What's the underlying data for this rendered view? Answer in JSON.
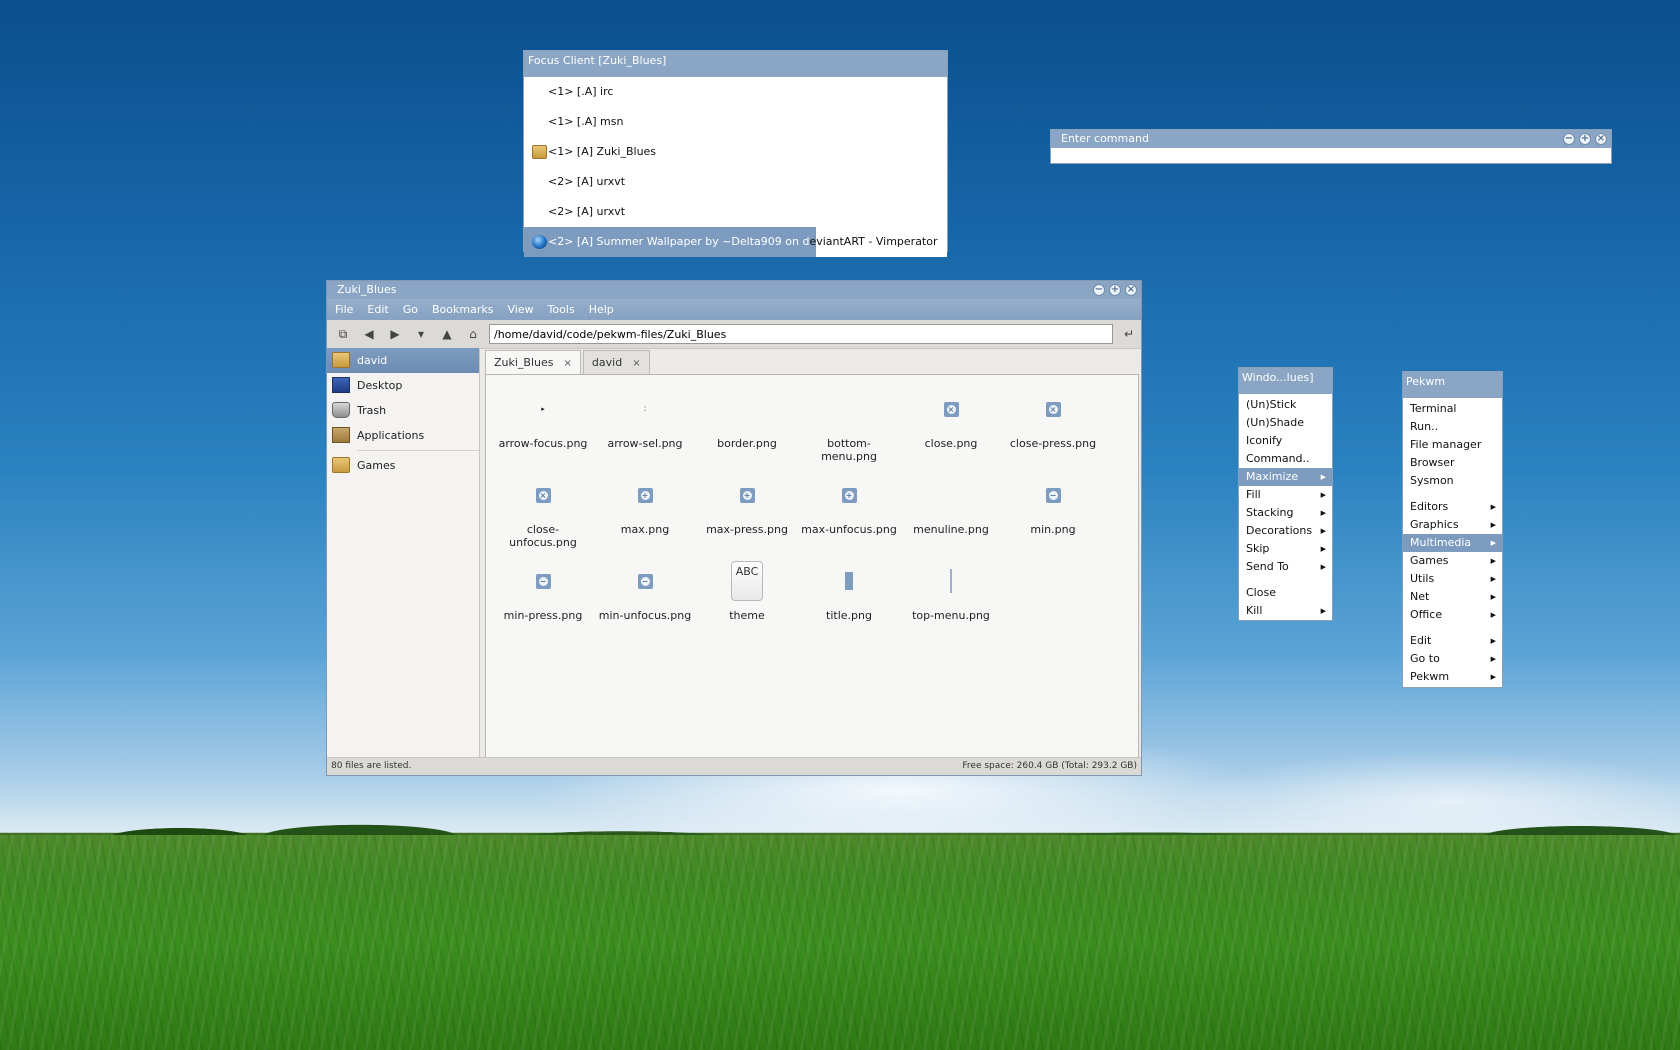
{
  "focus_window": {
    "title": "Focus Client [Zuki_Blues]",
    "items": [
      {
        "label": "<1> [.A] irc",
        "icon": "none"
      },
      {
        "label": "<1> [.A] msn",
        "icon": "none"
      },
      {
        "label": "<1> [A] Zuki_Blues",
        "icon": "folder-icon"
      },
      {
        "label": "<2> [A] urxvt",
        "icon": "none"
      },
      {
        "label": "<2> [A] urxvt",
        "icon": "none"
      },
      {
        "label_selected": "<2> [A] Summer Wallpaper by ~Delta909 on d",
        "label_tail": "eviantART - Vimperator",
        "icon": "globe-icon"
      }
    ]
  },
  "command_window": {
    "title": "Enter command",
    "value": ""
  },
  "file_manager": {
    "title": "Zuki_Blues",
    "menu": [
      "File",
      "Edit",
      "Go",
      "Bookmarks",
      "View",
      "Tools",
      "Help"
    ],
    "path": "/home/david/code/pekwm-files/Zuki_Blues",
    "sidebar": [
      {
        "label": "david",
        "icon": "home-folder-icon"
      },
      {
        "label": "Desktop",
        "icon": "desktop-icon"
      },
      {
        "label": "Trash",
        "icon": "trash-icon"
      },
      {
        "label": "Applications",
        "icon": "applications-icon"
      },
      {
        "label": "Games",
        "icon": "folder-icon"
      }
    ],
    "tabs": [
      {
        "label": "Zuki_Blues",
        "close": "×"
      },
      {
        "label": "david",
        "close": "×"
      }
    ],
    "files": [
      {
        "name": "arrow-focus.png",
        "thumb": "arrow"
      },
      {
        "name": "arrow-sel.png",
        "thumb": "dots"
      },
      {
        "name": "border.png",
        "thumb": "blank"
      },
      {
        "name": "bottom-menu.png",
        "thumb": "blank"
      },
      {
        "name": "close.png",
        "thumb": "close"
      },
      {
        "name": "close-press.png",
        "thumb": "close"
      },
      {
        "name": "close-unfocus.png",
        "thumb": "close"
      },
      {
        "name": "max.png",
        "thumb": "max"
      },
      {
        "name": "max-press.png",
        "thumb": "max"
      },
      {
        "name": "max-unfocus.png",
        "thumb": "max"
      },
      {
        "name": "menuline.png",
        "thumb": "blank"
      },
      {
        "name": "min.png",
        "thumb": "min"
      },
      {
        "name": "min-press.png",
        "thumb": "min"
      },
      {
        "name": "min-unfocus.png",
        "thumb": "min"
      },
      {
        "name": "theme",
        "thumb": "abc"
      },
      {
        "name": "title.png",
        "thumb": "bar"
      },
      {
        "name": "top-menu.png",
        "thumb": "line"
      }
    ],
    "theme_thumb_text": "ABC",
    "status_left": "80 files are listed.",
    "status_right": "Free space: 260.4 GB (Total: 293.2 GB)"
  },
  "window_menu": {
    "title": "Windo...lues]",
    "items": [
      {
        "label": "(Un)Stick",
        "submenu": false
      },
      {
        "label": "(Un)Shade",
        "submenu": false
      },
      {
        "label": "Iconify",
        "submenu": false
      },
      {
        "label": "Command..",
        "submenu": false
      },
      {
        "label": "Maximize",
        "submenu": true,
        "selected": true
      },
      {
        "label": "Fill",
        "submenu": true
      },
      {
        "label": "Stacking",
        "submenu": true
      },
      {
        "label": "Decorations",
        "submenu": true
      },
      {
        "label": "Skip",
        "submenu": true
      },
      {
        "label": "Send To",
        "submenu": true
      },
      {
        "gap": true
      },
      {
        "label": "Close",
        "submenu": false
      },
      {
        "label": "Kill",
        "submenu": true
      }
    ]
  },
  "pekwm_menu": {
    "title": "Pekwm",
    "items": [
      {
        "label": "Terminal",
        "submenu": false
      },
      {
        "label": "Run..",
        "submenu": false
      },
      {
        "label": "File manager",
        "submenu": false
      },
      {
        "label": "Browser",
        "submenu": false
      },
      {
        "label": "Sysmon",
        "submenu": false
      },
      {
        "gap": true
      },
      {
        "label": "Editors",
        "submenu": true
      },
      {
        "label": "Graphics",
        "submenu": true
      },
      {
        "label": "Multimedia",
        "submenu": true,
        "selected": true
      },
      {
        "label": "Games",
        "submenu": true
      },
      {
        "label": "Utils",
        "submenu": true
      },
      {
        "label": "Net",
        "submenu": true
      },
      {
        "label": "Office",
        "submenu": true
      },
      {
        "gap": true
      },
      {
        "label": "Edit",
        "submenu": true
      },
      {
        "label": "Go to",
        "submenu": true
      },
      {
        "label": "Pekwm",
        "submenu": true
      }
    ]
  },
  "colors": {
    "accent": "#7d9bbe",
    "titlebar": "#8aa6c4"
  }
}
